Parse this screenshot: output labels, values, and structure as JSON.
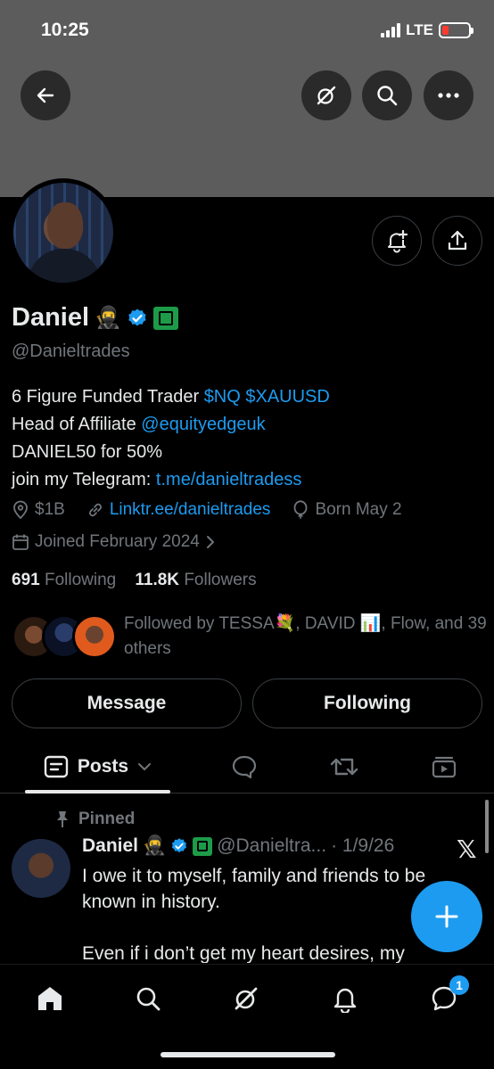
{
  "status": {
    "time": "10:25",
    "network": "LTE"
  },
  "profile": {
    "name": "Daniel",
    "name_emoji": "🥷",
    "handle": "@Danieltrades",
    "bio": {
      "line1_text": "6 Figure Funded Trader ",
      "line1_tags": "$NQ $XAUUSD",
      "line2_text": "Head of Affiliate ",
      "line2_mention": "@equityedgeuk",
      "line3": "DANIEL50 for 50%",
      "line4_text": "join my Telegram: ",
      "line4_link": "t.me/danieltradess"
    },
    "location": "$1B",
    "website": "Linktr.ee/danieltrades",
    "birthday": "Born May 2",
    "joined": "Joined February 2024",
    "following_count": "691",
    "following_label": "Following",
    "followers_count": "11.8K",
    "followers_label": "Followers",
    "followed_by": "Followed by TESSA💐, DAVID 📊, Flow, and 39 others"
  },
  "buttons": {
    "message": "Message",
    "following": "Following"
  },
  "tabs": {
    "posts": "Posts"
  },
  "post": {
    "pinned_label": "Pinned",
    "author": "Daniel",
    "author_emoji": "🥷",
    "handle": "@Danieltra...",
    "date": "· 1/9/26",
    "text": "I owe it to myself, family and friends to be known in history.\n\nEven if i don’t get my heart desires, my"
  },
  "nav": {
    "badge_count": "1"
  },
  "colors": {
    "accent": "#1d9bf0",
    "affiliate_green": "#1d9b48",
    "muted": "#71767b",
    "banner": "#5c5c5c"
  }
}
